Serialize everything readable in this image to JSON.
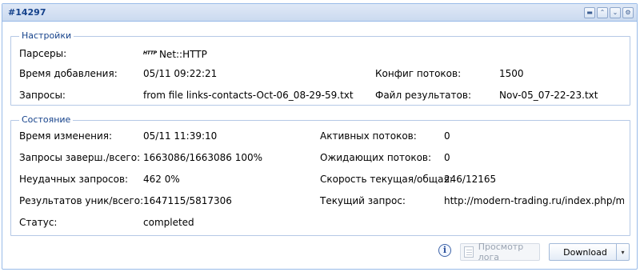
{
  "panel": {
    "title": "#14297",
    "tools": [
      {
        "name": "minimize-icon",
        "glyph": "▬"
      },
      {
        "name": "collapse-up-icon",
        "glyph": "⌃"
      },
      {
        "name": "expand-down-icon",
        "glyph": "⌄"
      },
      {
        "name": "gear-icon",
        "glyph": "⚙"
      }
    ]
  },
  "settings": {
    "legend": "Настройки",
    "parsers_label": "Парсеры:",
    "parsers_icon_text": "HTTP",
    "parsers_value": "Net::HTTP",
    "added_time_label": "Время добавления:",
    "added_time_value": "05/11 09:22:21",
    "threads_config_label": "Конфиг потоков:",
    "threads_config_value": "1500",
    "queries_label": "Запросы:",
    "queries_value": "from file links-contacts-Oct-06_08-29-59.txt",
    "results_file_label": "Файл результатов:",
    "results_file_value": "Nov-05_07-22-23.txt"
  },
  "status": {
    "legend": "Состояние",
    "changed_time_label": "Время изменения:",
    "changed_time_value": "05/11 11:39:10",
    "active_threads_label": "Активных потоков:",
    "active_threads_value": "0",
    "queries_done_label": "Запросы заверш./всего:",
    "queries_done_value": "1663086/1663086 100%",
    "waiting_threads_label": "Ожидающих потоков:",
    "waiting_threads_value": "0",
    "failed_queries_label": "Неудачных запросов:",
    "failed_queries_value": "462 0%",
    "speed_label": "Скорость текущая/общая:",
    "speed_value": "246/12165",
    "results_label": "Результатов уник/всего:",
    "results_value": "1647115/5817306",
    "current_query_label": "Текущий запрос:",
    "current_query_value": "http://modern-trading.ru/index.php/magi:",
    "state_label": "Статус:",
    "state_value": "completed"
  },
  "footer": {
    "info_glyph": "i",
    "view_log_label": "Просмотр лога",
    "download_label": "Download",
    "download_arrow": "▾"
  }
}
